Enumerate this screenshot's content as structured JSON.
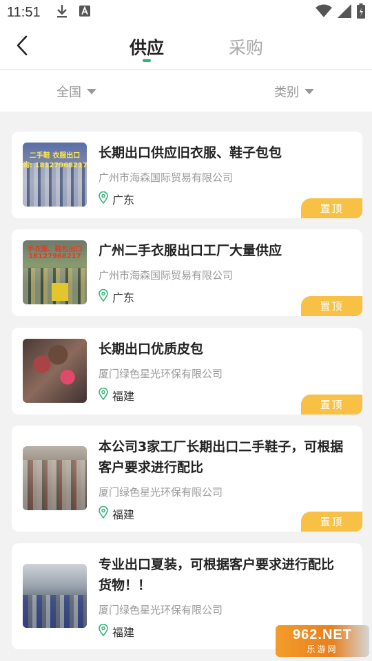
{
  "status_bar": {
    "time": "11:51"
  },
  "header": {
    "tabs": [
      {
        "label": "供应"
      },
      {
        "label": "采购"
      }
    ]
  },
  "filters": {
    "region": "全国",
    "category": "类别"
  },
  "listings": [
    {
      "title": "长期出口供应旧衣服、鞋子包包",
      "company": "广州市海森国际贸易有限公司",
      "location": "广东",
      "badge": "置顶",
      "image_text_1": "二手鞋 衣服出口",
      "image_text_2": "询: 18127968217"
    },
    {
      "title": "广州二手衣服出口工厂大量供应",
      "company": "广州市海森国际贸易有限公司",
      "location": "广东",
      "badge": "置顶",
      "image_text_1": "手衣服、鞋包出口",
      "image_text_2": "18127968217"
    },
    {
      "title": "长期出口优质皮包",
      "company": "厦门绿色星光环保有限公司",
      "location": "福建",
      "badge": "置顶"
    },
    {
      "title_line1": "本公司3家工厂长期出口二手鞋子，可根据",
      "title_line2": "客户要求进行配比",
      "company": "厦门绿色星光环保有限公司",
      "location": "福建",
      "badge": "置顶"
    },
    {
      "title_line1": "专业出口夏装，可根据客户要求进行配比",
      "title_line2": "货物！！",
      "company": "厦门绿色星光环保有限公司",
      "location": "福建"
    }
  ],
  "watermark": {
    "big": "962.NET",
    "small": "乐游网"
  },
  "colors": {
    "accent": "#2fb67a",
    "badge": "#f8c146",
    "location_icon": "#2fb67a"
  }
}
